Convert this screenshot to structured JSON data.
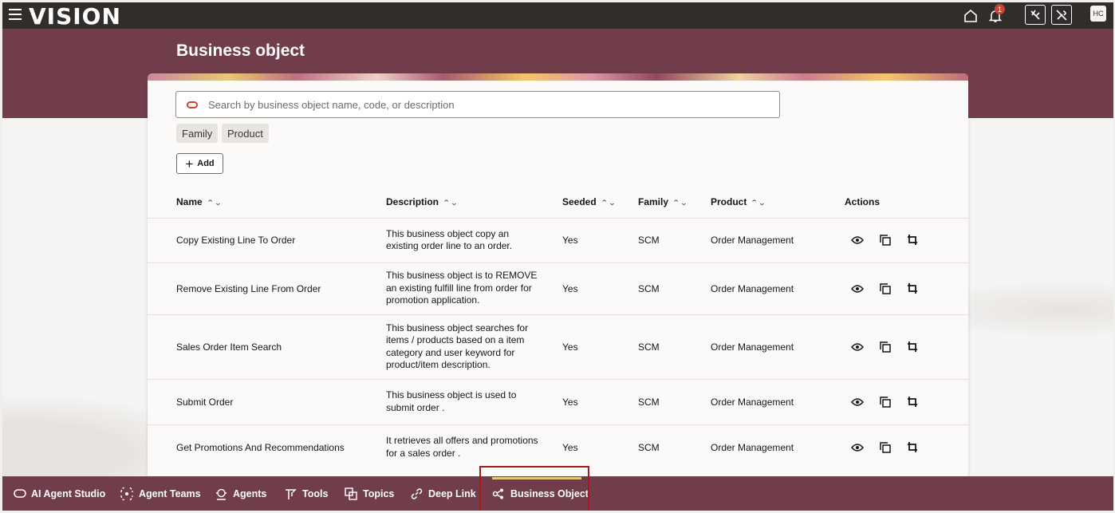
{
  "app": {
    "logo": "VISION",
    "notification_count": "1",
    "user_initials": "HC"
  },
  "page": {
    "title": "Business object"
  },
  "search": {
    "placeholder": "Search by business object name, code, or description"
  },
  "filters": [
    "Family",
    "Product"
  ],
  "toolbar": {
    "add_label": "Add"
  },
  "table": {
    "columns": {
      "name": "Name",
      "description": "Description",
      "seeded": "Seeded",
      "family": "Family",
      "product": "Product",
      "actions": "Actions"
    },
    "rows": [
      {
        "name": "Copy Existing Line To Order",
        "description": "This business object copy an existing order line to an order.",
        "seeded": "Yes",
        "family": "SCM",
        "product": "Order Management"
      },
      {
        "name": "Remove Existing Line From Order",
        "description": "This business object is to REMOVE an existing fulfill line from order for promotion application.",
        "seeded": "Yes",
        "family": "SCM",
        "product": "Order Management"
      },
      {
        "name": "Sales Order Item Search",
        "description": "This business object searches for items / products based on a item category and user keyword for product/item description.",
        "seeded": "Yes",
        "family": "SCM",
        "product": "Order Management"
      },
      {
        "name": "Submit Order",
        "description": "This business object is used to submit order .",
        "seeded": "Yes",
        "family": "SCM",
        "product": "Order Management"
      },
      {
        "name": "Get Promotions And Recommendations",
        "description": "It retrieves all offers and promotions for a sales order .",
        "seeded": "Yes",
        "family": "SCM",
        "product": "Order Management"
      }
    ]
  },
  "bottom_nav": [
    {
      "label": "AI Agent Studio",
      "icon": "oracle-ring-icon"
    },
    {
      "label": "Agent Teams",
      "icon": "agent-teams-icon"
    },
    {
      "label": "Agents",
      "icon": "agents-icon"
    },
    {
      "label": "Tools",
      "icon": "tools-icon"
    },
    {
      "label": "Topics",
      "icon": "topics-icon"
    },
    {
      "label": "Deep Link",
      "icon": "link-icon"
    },
    {
      "label": "Business Object",
      "icon": "business-object-icon",
      "active": true
    }
  ],
  "colors": {
    "topbar": "#312d2a",
    "brand_band": "#713d4b",
    "highlight": "#a4191c",
    "accent": "#c74634"
  }
}
